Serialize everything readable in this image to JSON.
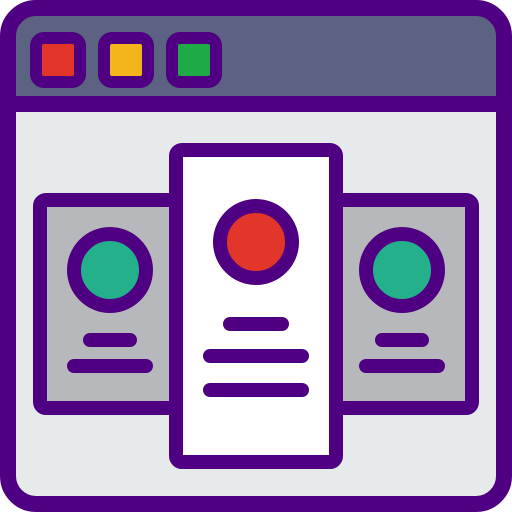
{
  "icon": {
    "name": "browser-card-carousel-icon",
    "colors": {
      "outline": "#4f0082",
      "titlebar": "#5c6282",
      "window_body": "#e6eaea",
      "side_card": "#b6b8bb",
      "center_card": "#ffffff",
      "red": "#e3362b",
      "yellow": "#f2b51b",
      "green": "#1faa48",
      "teal_avatar": "#25b08c",
      "red_avatar": "#e3362b"
    },
    "window_buttons": [
      {
        "name": "close-dot-icon",
        "color_key": "red"
      },
      {
        "name": "minimize-dot-icon",
        "color_key": "yellow"
      },
      {
        "name": "maximize-dot-icon",
        "color_key": "green"
      }
    ],
    "cards": [
      {
        "name": "left-card",
        "avatar_color_key": "teal_avatar"
      },
      {
        "name": "center-card",
        "avatar_color_key": "red_avatar"
      },
      {
        "name": "right-card",
        "avatar_color_key": "teal_avatar"
      }
    ]
  }
}
